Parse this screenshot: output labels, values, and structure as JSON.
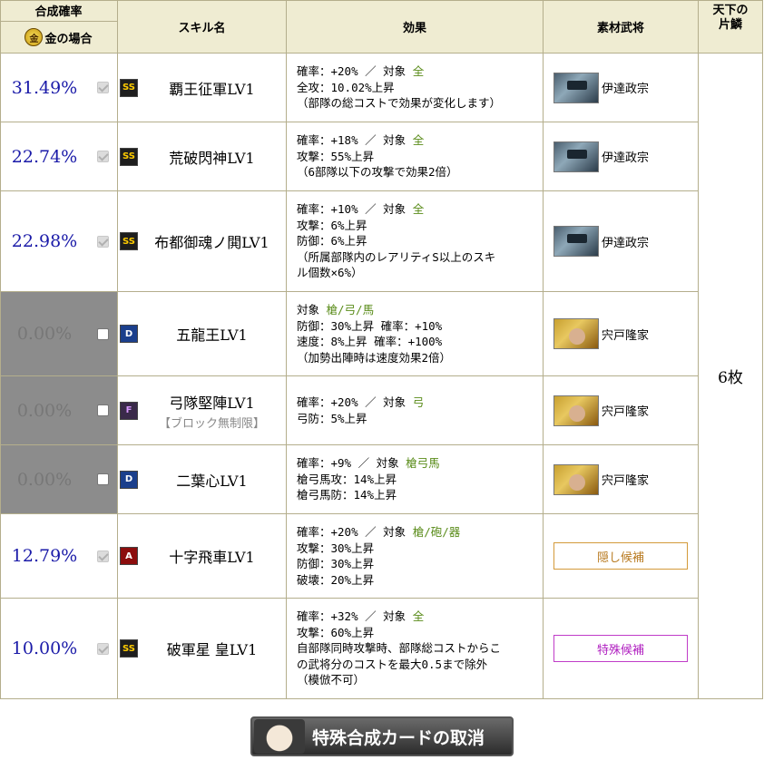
{
  "header": {
    "rate_label": "合成確率",
    "gold_icon_char": "金",
    "gold_label": "金の場合",
    "skill_name_label": "スキル名",
    "effect_label": "効果",
    "material_label": "素材武将",
    "shard_label": "天下の\n片鱗"
  },
  "rows": [
    {
      "rate": "31.49%",
      "checked": true,
      "rank": "SS",
      "skill": "覇王征軍LV1",
      "skill_sub": "",
      "effects": [
        [
          "確率：+20% ／ 対象 ",
          "全"
        ],
        [
          "全攻：10.02%上昇",
          ""
        ],
        [
          "（部隊の総コストで効果が変化します）",
          ""
        ]
      ],
      "material": "伊達政宗",
      "material_type": "date"
    },
    {
      "rate": "22.74%",
      "checked": true,
      "rank": "SS",
      "skill": "荒破閃神LV1",
      "skill_sub": "",
      "effects": [
        [
          "確率：+18% ／ 対象 ",
          "全"
        ],
        [
          "攻撃：55%上昇",
          ""
        ],
        [
          "（6部隊以下の攻撃で効果2倍）",
          ""
        ]
      ],
      "material": "伊達政宗",
      "material_type": "date"
    },
    {
      "rate": "22.98%",
      "checked": true,
      "rank": "SS",
      "skill": "布都御魂ノ閧LV1",
      "skill_sub": "",
      "effects": [
        [
          "確率：+10% ／ 対象 ",
          "全"
        ],
        [
          "攻撃：6%上昇",
          ""
        ],
        [
          "防御：6%上昇",
          ""
        ],
        [
          "（所属部隊内のレアリティS以上のスキ",
          ""
        ],
        [
          "ル個数×6%）",
          ""
        ]
      ],
      "material": "伊達政宗",
      "material_type": "date"
    },
    {
      "rate": "0.00%",
      "checked": false,
      "rank": "D",
      "skill": "五龍王LV1",
      "skill_sub": "",
      "effects": [
        [
          "対象 ",
          "槍/弓/馬"
        ],
        [
          "防御：30%上昇 確率：+10%",
          ""
        ],
        [
          "速度：8%上昇 確率：+100%",
          ""
        ],
        [
          "（加勢出陣時は速度効果2倍）",
          ""
        ]
      ],
      "material": "宍戸隆家",
      "material_type": "shi"
    },
    {
      "rate": "0.00%",
      "checked": false,
      "rank": "F",
      "skill": "弓隊堅陣LV1",
      "skill_sub": "【ブロック無制限】",
      "effects": [
        [
          "確率：+20% ／ 対象 ",
          "弓"
        ],
        [
          "弓防：5%上昇",
          ""
        ]
      ],
      "material": "宍戸隆家",
      "material_type": "shi"
    },
    {
      "rate": "0.00%",
      "checked": false,
      "rank": "D",
      "skill": "二葉心LV1",
      "skill_sub": "",
      "effects": [
        [
          "確率：+9% ／ 対象 ",
          "槍弓馬"
        ],
        [
          "槍弓馬攻：14%上昇",
          ""
        ],
        [
          "槍弓馬防：14%上昇",
          ""
        ]
      ],
      "material": "宍戸隆家",
      "material_type": "shi"
    },
    {
      "rate": "12.79%",
      "checked": true,
      "rank": "A",
      "skill": "十字飛車LV1",
      "skill_sub": "",
      "effects": [
        [
          "確率：+20% ／ 対象 ",
          "槍/砲/器"
        ],
        [
          "攻撃：30%上昇",
          ""
        ],
        [
          "防御：30%上昇",
          ""
        ],
        [
          "破壊：20%上昇",
          ""
        ]
      ],
      "material": "隠し候補",
      "material_type": "hidden"
    },
    {
      "rate": "10.00%",
      "checked": true,
      "rank": "SS",
      "skill": "破軍星 皇LV1",
      "skill_sub": "",
      "effects": [
        [
          "確率：+32% ／ 対象 ",
          "全"
        ],
        [
          "攻撃：60%上昇",
          ""
        ],
        [
          "自部隊同時攻撃時、部隊総コストからこ",
          ""
        ],
        [
          "の武将分のコストを最大0.5まで除外",
          ""
        ],
        [
          "（模倣不可）",
          ""
        ]
      ],
      "material": "特殊候補",
      "material_type": "special"
    }
  ],
  "shard_value": "6枚",
  "cancel_button_label": "特殊合成カードの取消"
}
